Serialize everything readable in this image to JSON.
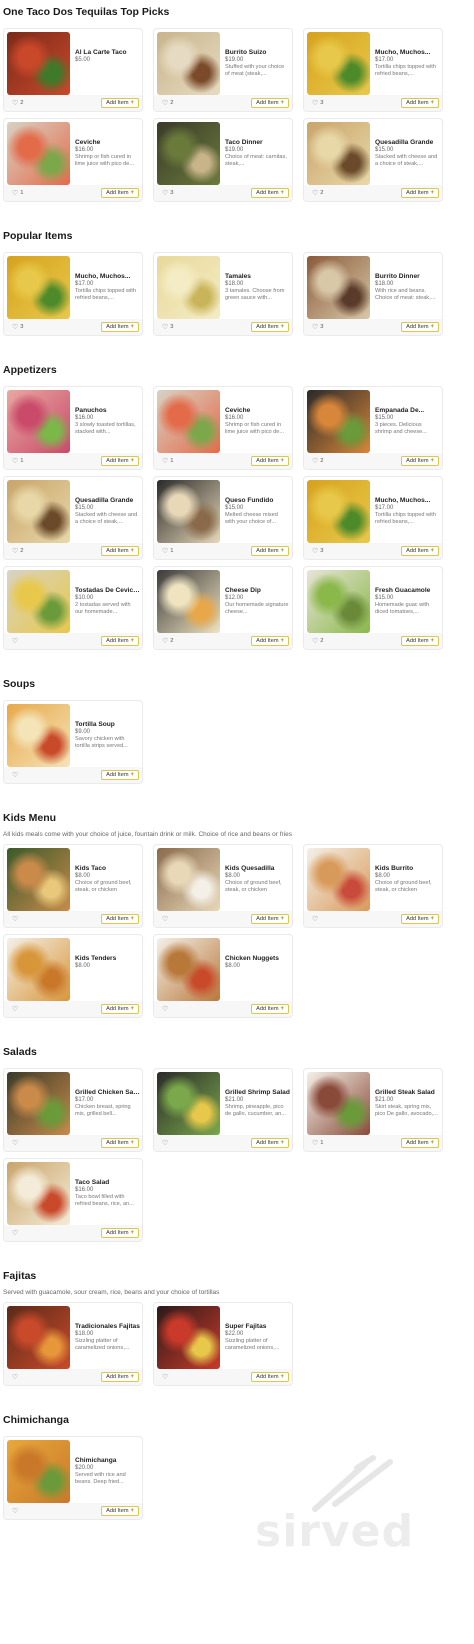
{
  "sections": [
    {
      "title": "One Taco Dos Tequilas Top Picks",
      "description": "",
      "items": [
        {
          "name": "Al La Carte Taco",
          "price": "$5.00",
          "desc": "",
          "likes": "2",
          "add_label": "Add Item",
          "thumb": [
            "#7a2a1a",
            "#c9482a",
            "#3f7a2a"
          ]
        },
        {
          "name": "Burrito Suizo",
          "price": "$19.00",
          "desc": "Stuffed with your choice of meat (steak,...",
          "likes": "2",
          "add_label": "Add Item",
          "thumb": [
            "#c9b48a",
            "#e6dbc2",
            "#7a4a2a"
          ]
        },
        {
          "name": "Mucho, Muchos...",
          "price": "$17.00",
          "desc": "Tortilla chips topped with refried beans,...",
          "likes": "3",
          "add_label": "Add Item",
          "thumb": [
            "#d6a21e",
            "#e8c84a",
            "#4f8a2a"
          ]
        },
        {
          "name": "Ceviche",
          "price": "$16.00",
          "desc": "Shrimp or fish cured in lime juice with pico de...",
          "likes": "1",
          "add_label": "Add Item",
          "thumb": [
            "#d8d2c4",
            "#e36b4a",
            "#7aa84a"
          ]
        },
        {
          "name": "Taco Dinner",
          "price": "$19.00",
          "desc": "Choice of meat: carnitas, steak,...",
          "likes": "3",
          "add_label": "Add Item",
          "thumb": [
            "#3a3a2a",
            "#6a7a3a",
            "#c9b48a"
          ]
        },
        {
          "name": "Quesadilla Grande",
          "price": "$15.00",
          "desc": "Stacked with cheese and a choice of steak,...",
          "likes": "2",
          "add_label": "Add Item",
          "thumb": [
            "#c9a46a",
            "#e8d8a8",
            "#6a4a2a"
          ]
        }
      ]
    },
    {
      "title": "Popular Items",
      "description": "",
      "items": [
        {
          "name": "Mucho, Muchos...",
          "price": "$17.00",
          "desc": "Tortilla chips topped with refried beans,...",
          "likes": "3",
          "add_label": "Add Item",
          "thumb": [
            "#d6a21e",
            "#e8c84a",
            "#4f8a2a"
          ]
        },
        {
          "name": "Tamales",
          "price": "$18.00",
          "desc": "3 tamales. Choose from green sauce with...",
          "likes": "3",
          "add_label": "Add Item",
          "thumb": [
            "#e8d89a",
            "#f4ecc4",
            "#c9b45a"
          ]
        },
        {
          "name": "Burrito Dinner",
          "price": "$18.00",
          "desc": "With rice and beans. Choice of meat: steak,...",
          "likes": "3",
          "add_label": "Add Item",
          "thumb": [
            "#8a5a3a",
            "#d8c8a8",
            "#5a3a2a"
          ]
        }
      ]
    },
    {
      "title": "Appetizers",
      "description": "",
      "items": [
        {
          "name": "Panuchos",
          "price": "$16.00",
          "desc": "3 slowly toasted tortillas, stacked with...",
          "likes": "1",
          "add_label": "Add Item",
          "thumb": [
            "#e8a8a0",
            "#c94a6a",
            "#7ab84a"
          ]
        },
        {
          "name": "Ceviche",
          "price": "$16.00",
          "desc": "Shrimp or fish cured in lime juice with pico de...",
          "likes": "1",
          "add_label": "Add Item",
          "thumb": [
            "#d8d2c4",
            "#e36b4a",
            "#7aa84a"
          ]
        },
        {
          "name": "Empanada De...",
          "price": "$15.00",
          "desc": "3 pieces. Delicious shrimp and cheese...",
          "likes": "2",
          "add_label": "Add Item",
          "thumb": [
            "#2a2a2a",
            "#d8863a",
            "#6a9a3a"
          ]
        },
        {
          "name": "Quesadilla Grande",
          "price": "$15.00",
          "desc": "Stacked with cheese and a choice of steak,...",
          "likes": "2",
          "add_label": "Add Item",
          "thumb": [
            "#c9a46a",
            "#e8d8a8",
            "#6a4a2a"
          ]
        },
        {
          "name": "Queso Fundido",
          "price": "$15.00",
          "desc": "Melted cheese mixed with your choice of...",
          "likes": "1",
          "add_label": "Add Item",
          "thumb": [
            "#2a2a2a",
            "#e8d8b8",
            "#8a6a4a"
          ]
        },
        {
          "name": "Mucho, Muchos...",
          "price": "$17.00",
          "desc": "Tortilla chips topped with refried beans,...",
          "likes": "3",
          "add_label": "Add Item",
          "thumb": [
            "#d6a21e",
            "#e8c84a",
            "#4f8a2a"
          ]
        },
        {
          "name": "Tostadas De Ceviche",
          "price": "$10.00",
          "desc": "2 tostadas served with our homemade...",
          "likes": "",
          "add_label": "Add Item",
          "thumb": [
            "#d8d2c4",
            "#e8c84a",
            "#6a9a3a"
          ]
        },
        {
          "name": "Cheese Dip",
          "price": "$12.00",
          "desc": "Our homemade signature cheese...",
          "likes": "2",
          "add_label": "Add Item",
          "thumb": [
            "#3a3a3a",
            "#f0e4c0",
            "#e8a84a"
          ]
        },
        {
          "name": "Fresh Guacamole",
          "price": "$15.00",
          "desc": "Homemade guac with diced tomatoes,...",
          "likes": "2",
          "add_label": "Add Item",
          "thumb": [
            "#e8e4d8",
            "#8ab84a",
            "#6a8a3a"
          ]
        }
      ]
    },
    {
      "title": "Soups",
      "description": "",
      "items": [
        {
          "name": "Tortilla Soup",
          "price": "$9.00",
          "desc": "Savory chicken with tortilla strips served...",
          "likes": "",
          "add_label": "Add Item",
          "thumb": [
            "#e8a84a",
            "#f4e4b8",
            "#c94a2a"
          ]
        }
      ]
    },
    {
      "title": "Kids Menu",
      "description": "All kids meals come with your choice of juice, fountain drink or milk. Choice of rice and beans or fries",
      "items": [
        {
          "name": "Kids Taco",
          "price": "$8.00",
          "desc": "Choice of ground beef, steak, or chicken",
          "likes": "",
          "add_label": "Add Item",
          "thumb": [
            "#3a5a2a",
            "#c98a4a",
            "#e8c87a"
          ]
        },
        {
          "name": "Kids Quesadilla",
          "price": "$8.00",
          "desc": "Choice of ground beef, steak, or chicken",
          "likes": "",
          "add_label": "Add Item",
          "thumb": [
            "#8a6a4a",
            "#e8d8b8",
            "#f4f0e8"
          ]
        },
        {
          "name": "Kids Burrito",
          "price": "$8.00",
          "desc": "Choice of ground beef, steak, or chicken",
          "likes": "",
          "add_label": "Add Item",
          "thumb": [
            "#f4f0e8",
            "#d89a5a",
            "#c94a3a"
          ]
        },
        {
          "name": "Kids Tenders",
          "price": "$8.00",
          "desc": "",
          "likes": "",
          "add_label": "Add Item",
          "thumb": [
            "#f4f0e8",
            "#d8963a",
            "#c9782a"
          ]
        },
        {
          "name": "Chicken Nuggets",
          "price": "$8.00",
          "desc": "",
          "likes": "",
          "add_label": "Add Item",
          "thumb": [
            "#f4f0e8",
            "#b8783a",
            "#c94a2a"
          ]
        }
      ]
    },
    {
      "title": "Salads",
      "description": "",
      "items": [
        {
          "name": "Grilled Chicken Salad",
          "price": "$17.00",
          "desc": "Chicken breast, spring mix, grilled bell...",
          "likes": "",
          "add_label": "Add Item",
          "thumb": [
            "#3a3a2a",
            "#c98a4a",
            "#6a9a3a"
          ]
        },
        {
          "name": "Grilled Shrimp Salad",
          "price": "$21.00",
          "desc": "Shrimp, pineapple, pico de gallo, cucumber, an...",
          "likes": "",
          "add_label": "Add Item",
          "thumb": [
            "#2a2a2a",
            "#7aa84a",
            "#e8c84a"
          ]
        },
        {
          "name": "Grilled Steak Salad",
          "price": "$21.00",
          "desc": "Skirt steak, spring mix, pico De gallo, avocado,...",
          "likes": "1",
          "add_label": "Add Item",
          "thumb": [
            "#f4f0e8",
            "#8a4a3a",
            "#6a9a3a"
          ]
        },
        {
          "name": "Taco Salad",
          "price": "$16.00",
          "desc": "Taco bowl filled with refried beans, rice, an...",
          "likes": "",
          "add_label": "Add Item",
          "thumb": [
            "#c9a46a",
            "#f4ecd8",
            "#c94a2a"
          ]
        }
      ]
    },
    {
      "title": "Fajitas",
      "description": "Served with guacamole, sour cream, rice, beans and your choice of tortillas",
      "items": [
        {
          "name": "Tradicionales Fajitas",
          "price": "$18.00",
          "desc": "Sizzling platter of caramelized onions,...",
          "likes": "",
          "add_label": "Add Item",
          "thumb": [
            "#5a2a1a",
            "#c94a2a",
            "#e8963a"
          ]
        },
        {
          "name": "Super Fajitas",
          "price": "$22.00",
          "desc": "Sizzling platter of caramelized onions,...",
          "likes": "",
          "add_label": "Add Item",
          "thumb": [
            "#2a1a1a",
            "#c93a2a",
            "#e8c84a"
          ]
        }
      ]
    },
    {
      "title": "Chimichanga",
      "description": "",
      "items": [
        {
          "name": "Chimichanga",
          "price": "$20.00",
          "desc": "Served with rice and beans. Deep fried...",
          "likes": "",
          "add_label": "Add Item",
          "thumb": [
            "#e8a83a",
            "#c9782a",
            "#6a9a3a"
          ]
        }
      ]
    }
  ],
  "watermark": {
    "text": "sirved"
  }
}
